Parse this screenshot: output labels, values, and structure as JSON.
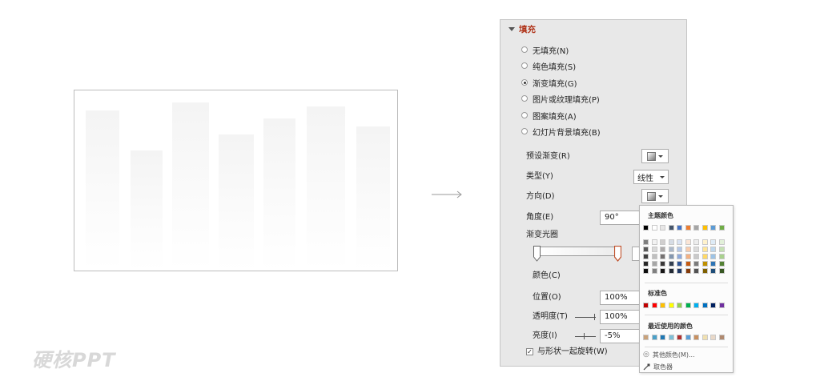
{
  "watermark": "硬核PPT",
  "fill_section": {
    "title": "填充",
    "options": [
      {
        "label": "无填充(N)",
        "selected": false
      },
      {
        "label": "纯色填充(S)",
        "selected": false
      },
      {
        "label": "渐变填充(G)",
        "selected": true
      },
      {
        "label": "图片或纹理填充(P)",
        "selected": false
      },
      {
        "label": "图案填充(A)",
        "selected": false
      },
      {
        "label": "幻灯片背景填充(B)",
        "selected": false
      }
    ]
  },
  "gradient": {
    "preset_label": "预设渐变(R)",
    "type_label": "类型(Y)",
    "type_value": "线性",
    "direction_label": "方向(D)",
    "angle_label": "角度(E)",
    "angle_value": "90°",
    "stops_label": "渐变光圈",
    "color_label": "颜色(C)",
    "position_label": "位置(O)",
    "position_value": "100%",
    "transparency_label": "透明度(T)",
    "transparency_value": "100%",
    "brightness_label": "亮度(I)",
    "brightness_value": "-5%",
    "rotate_label": "与形状一起旋转(W)",
    "rotate_checked": true
  },
  "color_picker": {
    "theme_title": "主题颜色",
    "standard_title": "标准色",
    "recent_title": "最近使用的颜色",
    "more_colors": "其他颜色(M)...",
    "eyedropper": "取色器",
    "theme_top": [
      "#000000",
      "#ffffff",
      "#e7e6e6",
      "#44546a",
      "#4472c4",
      "#ed7d31",
      "#a5a5a5",
      "#ffc000",
      "#5b9bd5",
      "#70ad47"
    ],
    "theme_cols": [
      [
        "#7f7f7f",
        "#595959",
        "#404040",
        "#262626",
        "#0d0d0d"
      ],
      [
        "#f2f2f2",
        "#d9d9d9",
        "#bfbfbf",
        "#a6a6a6",
        "#808080"
      ],
      [
        "#d0cece",
        "#aeabab",
        "#757171",
        "#3a3838",
        "#171616"
      ],
      [
        "#d6dce5",
        "#adb9ca",
        "#8497b0",
        "#333f50",
        "#222a35"
      ],
      [
        "#dae3f3",
        "#b4c7e7",
        "#8faadc",
        "#2f5597",
        "#1f3864"
      ],
      [
        "#fbe5d6",
        "#f8cbad",
        "#f4b183",
        "#c55a11",
        "#843c0c"
      ],
      [
        "#ededed",
        "#dbdbdb",
        "#c9c9c9",
        "#7b7b7b",
        "#525252"
      ],
      [
        "#fff2cc",
        "#ffe699",
        "#ffd966",
        "#bf9000",
        "#7f6000"
      ],
      [
        "#deebf7",
        "#bdd7ee",
        "#9dc3e6",
        "#2e75b6",
        "#1f4e79"
      ],
      [
        "#e2f0d9",
        "#c5e0b4",
        "#a9d18e",
        "#548235",
        "#385723"
      ]
    ],
    "standard": [
      "#c00000",
      "#ff0000",
      "#ffc000",
      "#ffff00",
      "#92d050",
      "#00b050",
      "#00b0f0",
      "#0070c0",
      "#002060",
      "#7030a0"
    ],
    "recent": [
      "#c9a27a",
      "#4aa0c8",
      "#1f78b4",
      "#7fbfd6",
      "#b03030",
      "#5a9ed6",
      "#c89060",
      "#f0e0b0",
      "#e8d8c8",
      "#b08a70"
    ]
  }
}
